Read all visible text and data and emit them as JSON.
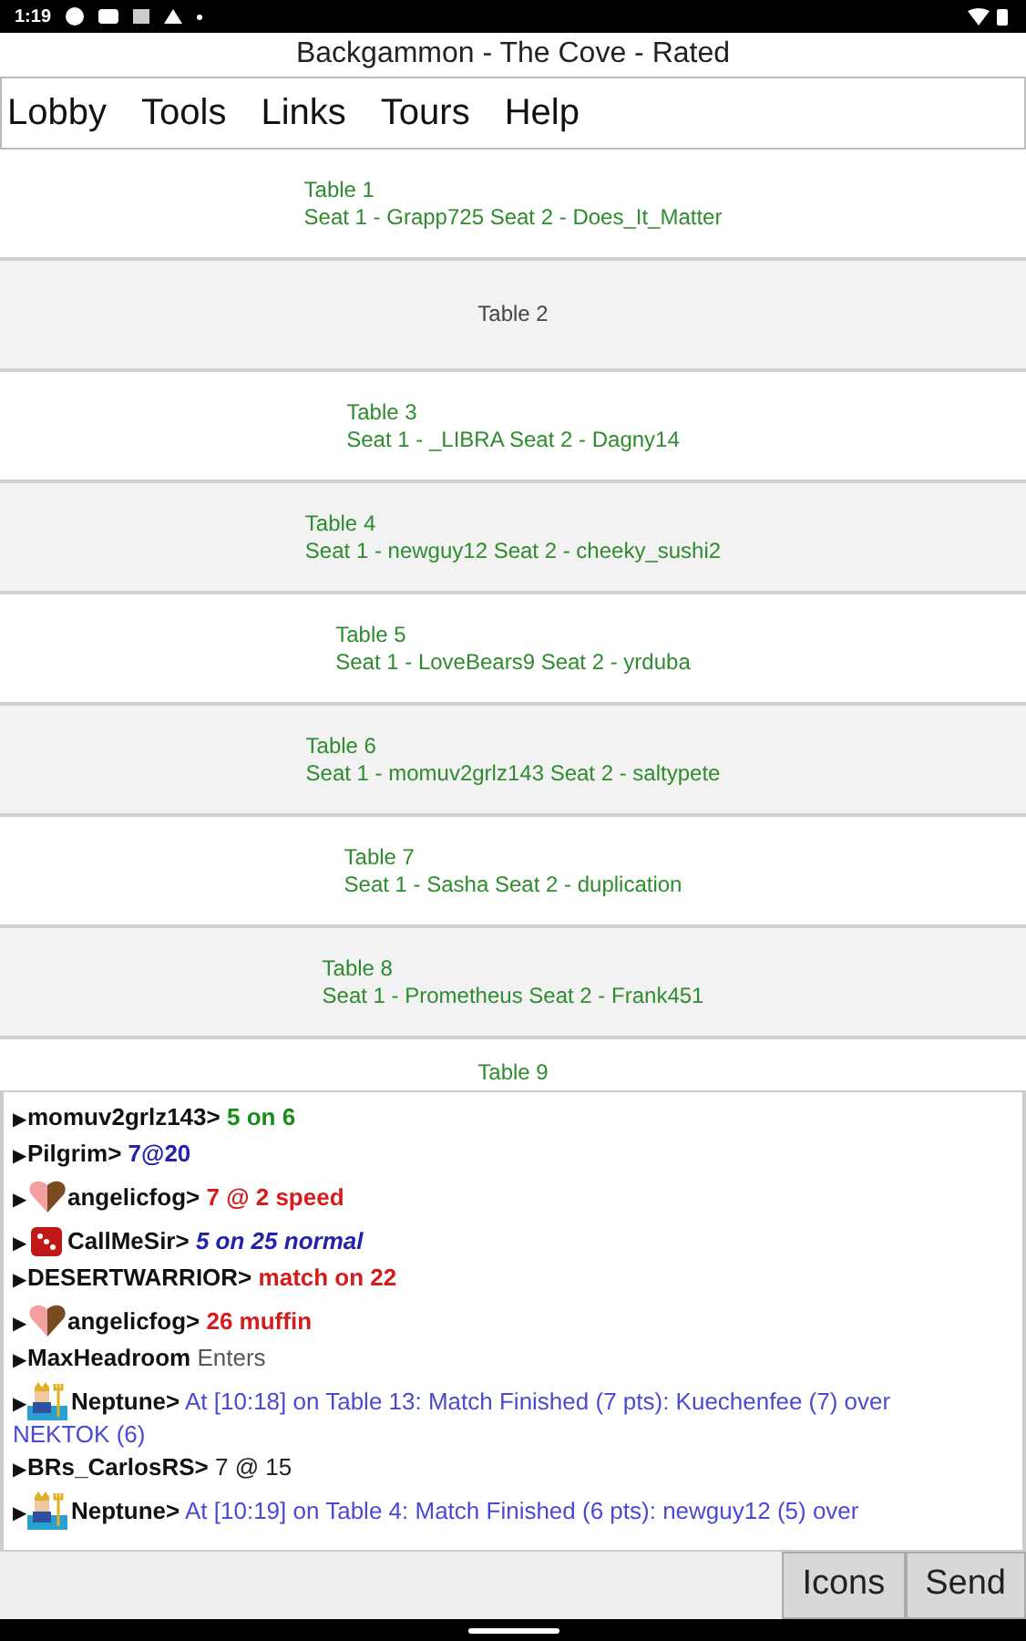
{
  "status_bar": {
    "time": "1:19"
  },
  "window": {
    "title": "Backgammon - The Cove - Rated"
  },
  "menu": [
    "Lobby",
    "Tools",
    "Links",
    "Tours",
    "Help"
  ],
  "tables": [
    {
      "name": "Table 1",
      "seats": "Seat 1 - Grapp725 Seat 2 - Does_It_Matter"
    },
    {
      "name": "Table 2"
    },
    {
      "name": "Table 3",
      "seats": "Seat 1 - _LIBRA Seat 2 - Dagny14"
    },
    {
      "name": "Table 4",
      "seats": "Seat 1 - newguy12 Seat 2 - cheeky_sushi2"
    },
    {
      "name": "Table 5",
      "seats": "Seat 1 - LoveBears9 Seat 2 - yrduba"
    },
    {
      "name": "Table 6",
      "seats": "Seat 1 - momuv2grlz143 Seat 2 - saltypete"
    },
    {
      "name": "Table 7",
      "seats": "Seat 1 - Sasha Seat 2 - duplication"
    },
    {
      "name": "Table 8",
      "seats": "Seat 1 - Prometheus Seat 2 - Frank451"
    },
    {
      "name": "Table 9"
    }
  ],
  "chat": [
    {
      "marker": "▶",
      "user": "momuv2grlz143>",
      "text": "5 on 6",
      "kind": "chat",
      "color": "#1a8a1a"
    },
    {
      "marker": "▶",
      "user": "Pilgrim>",
      "text": "7@20",
      "kind": "chat",
      "color": "#2222aa"
    },
    {
      "marker": "▶",
      "user": "angelicfog>",
      "text": "7 @ 2 speed",
      "kind": "heart-chat",
      "color": "#d41c1c"
    },
    {
      "marker": "▶",
      "user": "CallMeSir>",
      "text": "5 on 25 normal",
      "kind": "dice-chat-italic",
      "color": "#2222aa"
    },
    {
      "marker": "▶",
      "user": "DESERTWARRIOR>",
      "text": "match on 22",
      "kind": "chat",
      "color": "#d41c1c"
    },
    {
      "marker": "▶",
      "user": "angelicfog>",
      "text": "26 muffin",
      "kind": "heart-chat",
      "color": "#d41c1c"
    },
    {
      "marker": "▶",
      "user": "MaxHeadroom",
      "text": "Enters",
      "kind": "system",
      "color": "#555555"
    },
    {
      "marker": "▶",
      "user": "Neptune>",
      "text": "At [10:18] on Table 13: Match Finished (7 pts): Kuechenfee (7) over",
      "text_continued": "NEKTOK (6)",
      "kind": "figure-announce",
      "color": "#4a4ad0"
    },
    {
      "marker": "▶",
      "user": "BRs_CarlosRS>",
      "text": "7 @ 15",
      "kind": "plain",
      "color": "#222222"
    },
    {
      "marker": "▶",
      "user": "Neptune>",
      "text": "At [10:19] on Table 4: Match Finished (6 pts): newguy12 (5) over",
      "kind": "figure-announce",
      "color": "#4a4ad0"
    }
  ],
  "input": {
    "buttons": [
      "Icons",
      "Send"
    ]
  }
}
